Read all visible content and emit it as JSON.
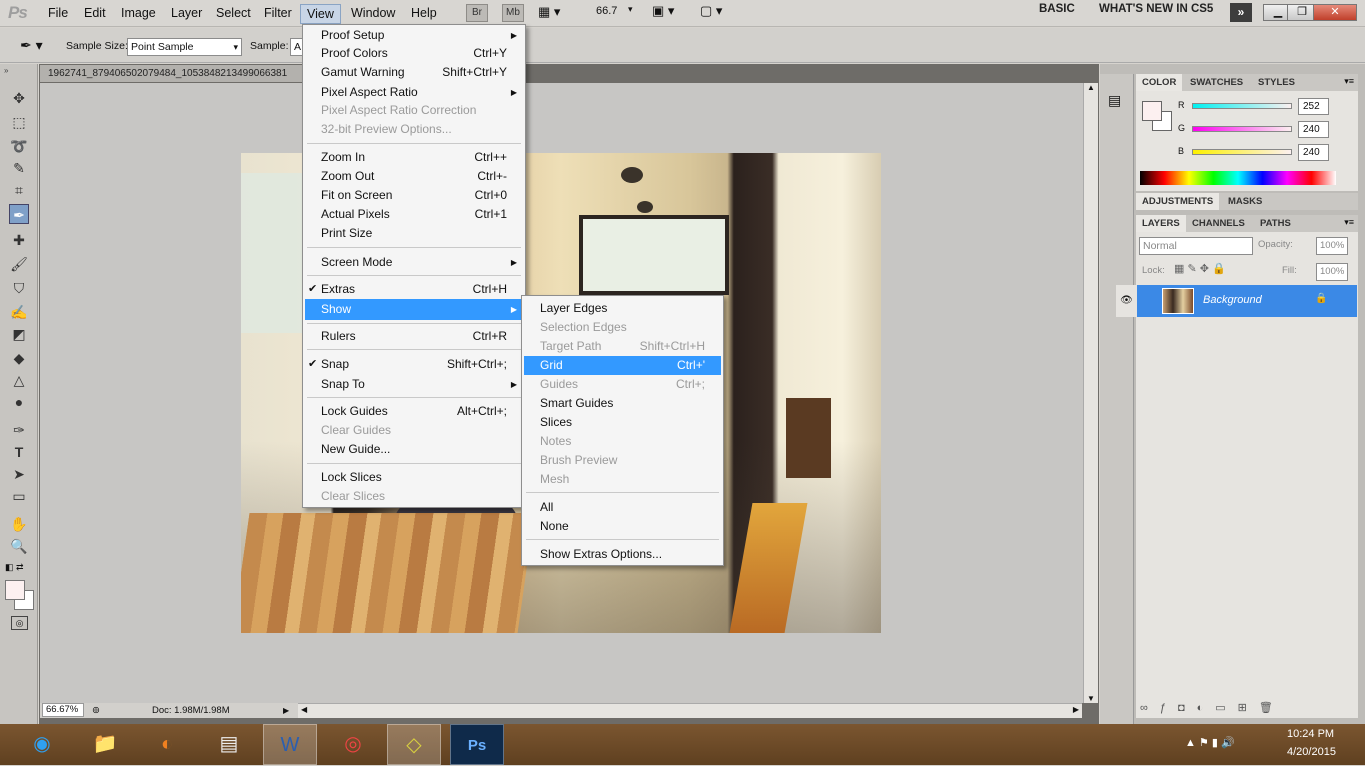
{
  "app": {
    "logo": "Ps",
    "title_file": "1962741_879406502079484_1053848213499066381",
    "zoom_menu": "66.7"
  },
  "menubar": [
    "File",
    "Edit",
    "Image",
    "Layer",
    "Select",
    "Filter",
    "View",
    "Window",
    "Help"
  ],
  "bridge_buttons": [
    "Br",
    "Mb"
  ],
  "workspace": {
    "basic": "BASIC",
    "whatsnew": "WHAT'S NEW IN CS5"
  },
  "options": {
    "sample_size_label": "Sample Size:",
    "sample_size_value": "Point Sample",
    "sample_label": "Sample:",
    "sample_value": "A"
  },
  "view_menu": {
    "items": [
      {
        "label": "Proof Setup",
        "shortcut": "",
        "arrow": true,
        "disabled": false
      },
      {
        "label": "Proof Colors",
        "shortcut": "Ctrl+Y",
        "disabled": false
      },
      {
        "label": "Gamut Warning",
        "shortcut": "Shift+Ctrl+Y",
        "disabled": false
      },
      {
        "label": "Pixel Aspect Ratio",
        "shortcut": "",
        "arrow": true,
        "disabled": false
      },
      {
        "label": "Pixel Aspect Ratio Correction",
        "shortcut": "",
        "disabled": true
      },
      {
        "label": "32-bit Preview Options...",
        "shortcut": "",
        "disabled": true
      },
      {
        "label": "Zoom In",
        "shortcut": "Ctrl++",
        "disabled": false
      },
      {
        "label": "Zoom Out",
        "shortcut": "Ctrl+-",
        "disabled": false
      },
      {
        "label": "Fit on Screen",
        "shortcut": "Ctrl+0",
        "disabled": false
      },
      {
        "label": "Actual Pixels",
        "shortcut": "Ctrl+1",
        "disabled": false
      },
      {
        "label": "Print Size",
        "shortcut": "",
        "disabled": false
      },
      {
        "label": "Screen Mode",
        "shortcut": "",
        "arrow": true,
        "disabled": false
      },
      {
        "label": "Extras",
        "shortcut": "Ctrl+H",
        "checked": true,
        "disabled": false
      },
      {
        "label": "Show",
        "shortcut": "",
        "arrow": true,
        "highlighted": true,
        "disabled": false
      },
      {
        "label": "Rulers",
        "shortcut": "Ctrl+R",
        "disabled": false
      },
      {
        "label": "Snap",
        "shortcut": "Shift+Ctrl+;",
        "checked": true,
        "disabled": false
      },
      {
        "label": "Snap To",
        "shortcut": "",
        "arrow": true,
        "disabled": false
      },
      {
        "label": "Lock Guides",
        "shortcut": "Alt+Ctrl+;",
        "disabled": false
      },
      {
        "label": "Clear Guides",
        "shortcut": "",
        "disabled": true
      },
      {
        "label": "New Guide...",
        "shortcut": "",
        "disabled": false
      },
      {
        "label": "Lock Slices",
        "shortcut": "",
        "disabled": false
      },
      {
        "label": "Clear Slices",
        "shortcut": "",
        "disabled": true
      }
    ]
  },
  "show_menu": {
    "items": [
      {
        "label": "Layer Edges",
        "shortcut": "",
        "disabled": false
      },
      {
        "label": "Selection Edges",
        "shortcut": "",
        "disabled": true
      },
      {
        "label": "Target Path",
        "shortcut": "Shift+Ctrl+H",
        "disabled": true
      },
      {
        "label": "Grid",
        "shortcut": "Ctrl+'",
        "highlighted": true,
        "disabled": false
      },
      {
        "label": "Guides",
        "shortcut": "Ctrl+;",
        "disabled": true
      },
      {
        "label": "Smart Guides",
        "shortcut": "",
        "disabled": false
      },
      {
        "label": "Slices",
        "shortcut": "",
        "disabled": false
      },
      {
        "label": "Notes",
        "shortcut": "",
        "disabled": true
      },
      {
        "label": "Brush Preview",
        "shortcut": "",
        "disabled": true
      },
      {
        "label": "Mesh",
        "shortcut": "",
        "disabled": true
      },
      {
        "label": "All",
        "shortcut": "",
        "disabled": false
      },
      {
        "label": "None",
        "shortcut": "",
        "disabled": false
      },
      {
        "label": "Show Extras Options...",
        "shortcut": "",
        "disabled": false
      }
    ]
  },
  "color_panel": {
    "tabs": [
      "COLOR",
      "SWATCHES",
      "STYLES"
    ],
    "r_label": "R",
    "g_label": "G",
    "b_label": "B",
    "r": "252",
    "g": "240",
    "b": "240",
    "fg_color": "#fcf0f0"
  },
  "adjust_tabs": [
    "ADJUSTMENTS",
    "MASKS"
  ],
  "layers_panel": {
    "tabs": [
      "LAYERS",
      "CHANNELS",
      "PATHS"
    ],
    "blend_mode": "Normal",
    "opacity_label": "Opacity:",
    "opacity": "100%",
    "lock_label": "Lock:",
    "fill_label": "Fill:",
    "fill": "100%",
    "layer_name": "Background"
  },
  "status": {
    "zoom": "66.67%",
    "doc": "Doc: 1.98M/1.98M"
  },
  "tray": {
    "time": "10:24 PM",
    "date": "4/20/2015"
  },
  "colors": {
    "highlight": "#3399ff",
    "layer_selected": "#3b89e6",
    "taskbar": "#6a4a26"
  }
}
